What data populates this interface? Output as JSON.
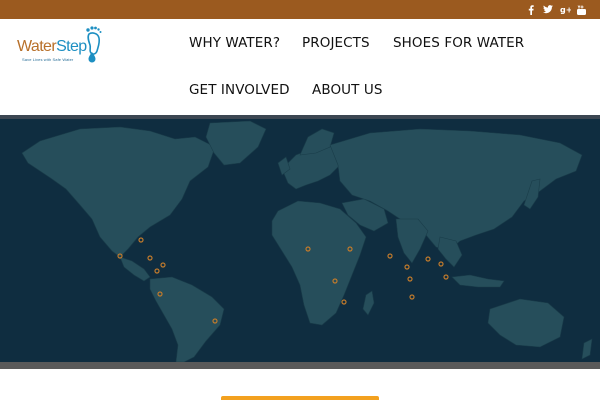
{
  "header": {
    "logo": {
      "word_water": "Water",
      "word_step": "Step",
      "tagline": "Save Lives with Safe Water"
    },
    "nav": [
      {
        "label": "WHY WATER?"
      },
      {
        "label": "PROJECTS"
      },
      {
        "label": "SHOES FOR WATER"
      },
      {
        "label": "GET INVOLVED"
      },
      {
        "label": "ABOUT US"
      }
    ]
  },
  "social": [
    {
      "icon": "facebook-icon"
    },
    {
      "icon": "twitter-icon"
    },
    {
      "icon": "google-plus-icon"
    },
    {
      "icon": "youtube-icon"
    }
  ],
  "colors": {
    "topbar": "#9b5a1f",
    "logo_water": "#b8702a",
    "logo_step": "#1d8fc2",
    "map_ocean": "#0f2d40",
    "map_land": "#264e5b",
    "map_marker": "#c07a2c",
    "cta": "#f3a11f"
  }
}
